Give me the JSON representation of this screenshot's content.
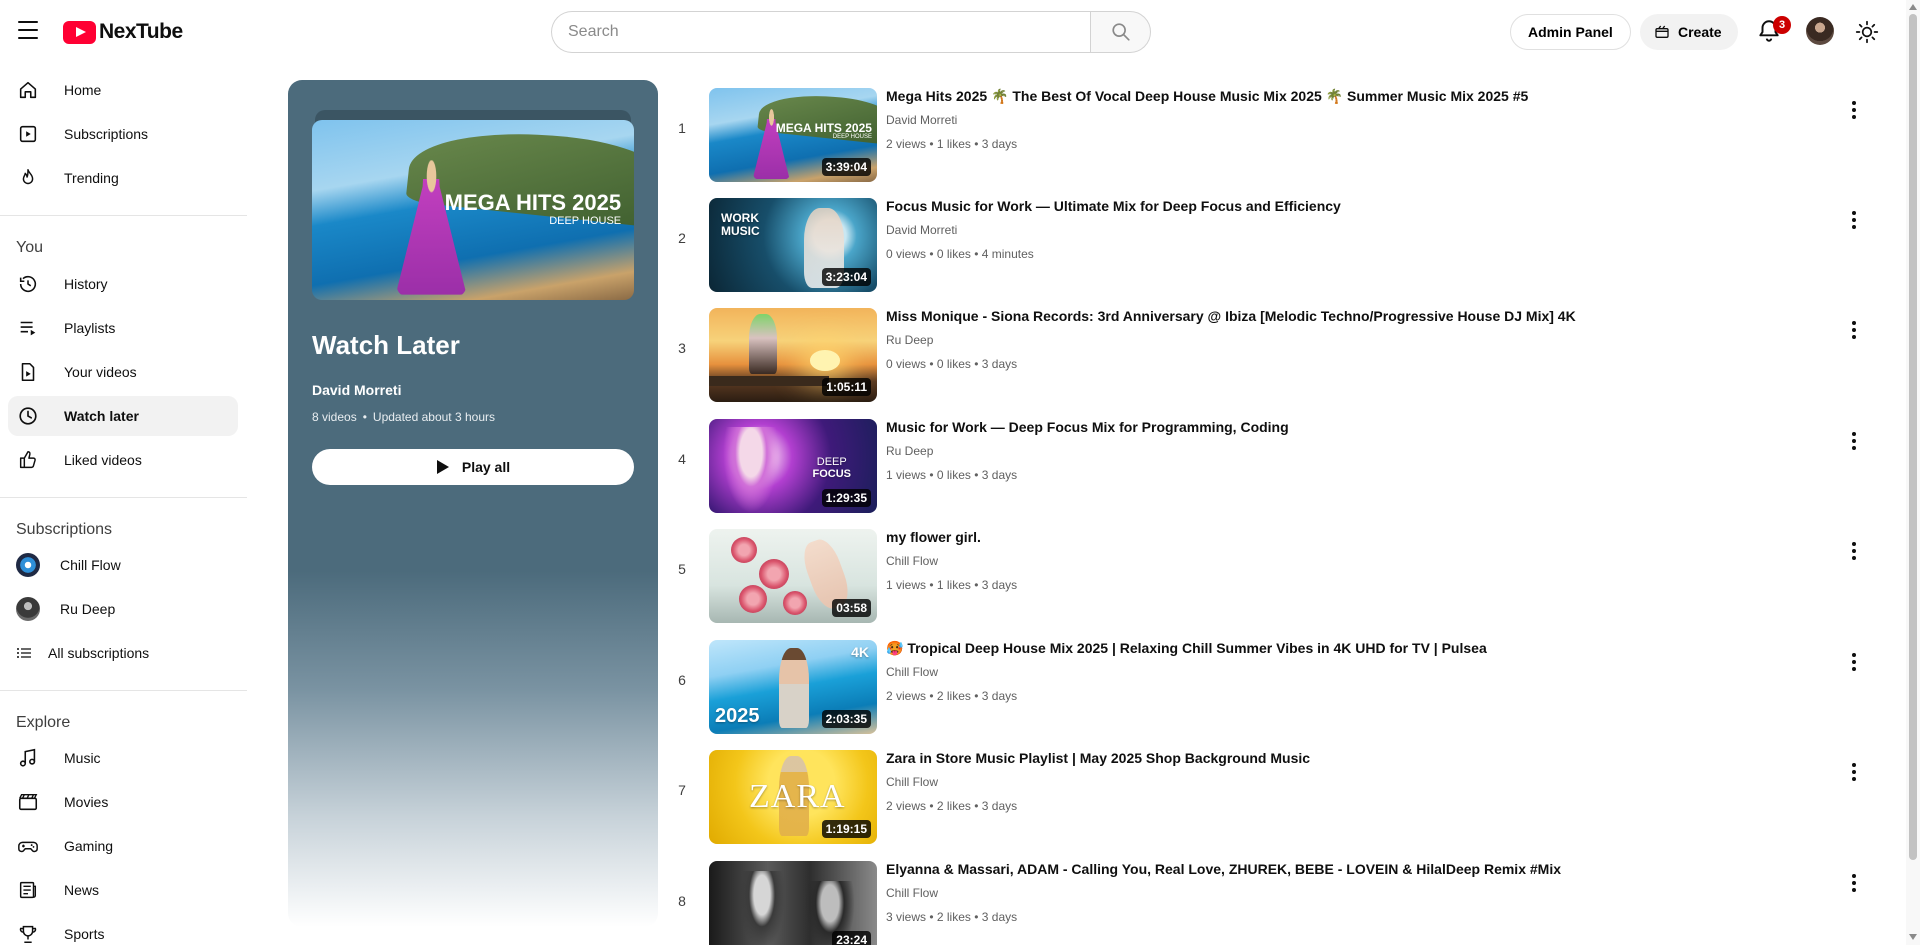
{
  "app": {
    "name": "NexTube",
    "search_placeholder": "Search",
    "admin_label": "Admin Panel",
    "create_label": "Create",
    "notification_count": "3"
  },
  "sidebar": {
    "main": [
      {
        "label": "Home",
        "icon": "home-icon"
      },
      {
        "label": "Subscriptions",
        "icon": "subscriptions-icon"
      },
      {
        "label": "Trending",
        "icon": "trending-icon"
      }
    ],
    "you_title": "You",
    "you": [
      {
        "label": "History",
        "icon": "history-icon"
      },
      {
        "label": "Playlists",
        "icon": "playlists-icon"
      },
      {
        "label": "Your videos",
        "icon": "your-videos-icon"
      },
      {
        "label": "Watch later",
        "icon": "watch-later-icon",
        "active": true
      },
      {
        "label": "Liked videos",
        "icon": "liked-videos-icon"
      }
    ],
    "subs_title": "Subscriptions",
    "subs": [
      {
        "label": "Chill Flow"
      },
      {
        "label": "Ru Deep"
      }
    ],
    "all_subs_label": "All subscriptions",
    "explore_title": "Explore",
    "explore": [
      {
        "label": "Music",
        "icon": "music-icon"
      },
      {
        "label": "Movies",
        "icon": "movies-icon"
      },
      {
        "label": "Gaming",
        "icon": "gaming-icon"
      },
      {
        "label": "News",
        "icon": "news-icon"
      },
      {
        "label": "Sports",
        "icon": "sports-icon"
      }
    ]
  },
  "playlist": {
    "title": "Watch Later",
    "owner": "David Morreti",
    "count": "8 videos",
    "updated": "Updated about 3 hours",
    "play_all_label": "Play all",
    "thumb_title": "MEGA HITS 2025",
    "thumb_subtitle": "DEEP HOUSE"
  },
  "videos": [
    {
      "index": "1",
      "title": "Mega Hits 2025 🌴 The Best Of Vocal Deep House Music Mix 2025 🌴 Summer Music Mix 2025 #5",
      "channel": "David Morreti",
      "meta": "2 views • 1 likes • 3 days",
      "duration": "3:39:04",
      "thumb_line1": "MEGA HITS 2025",
      "thumb_line2": "DEEP HOUSE"
    },
    {
      "index": "2",
      "title": "Focus Music for Work — Ultimate Mix for Deep Focus and Efficiency",
      "channel": "David Morreti",
      "meta": "0 views • 0 likes • 4 minutes",
      "duration": "3:23:04",
      "thumb_line1": "WORK",
      "thumb_line2": "MUSIC"
    },
    {
      "index": "3",
      "title": "Miss Monique - Siona Records: 3rd Anniversary @ Ibiza [Melodic Techno/Progressive House DJ Mix] 4K",
      "channel": "Ru Deep",
      "meta": "0 views • 0 likes • 3 days",
      "duration": "1:05:11"
    },
    {
      "index": "4",
      "title": "Music for Work — Deep Focus Mix for Programming, Coding",
      "channel": "Ru Deep",
      "meta": "1 views • 0 likes • 3 days",
      "duration": "1:29:35",
      "thumb_line1": "DEEP",
      "thumb_line2": "FOCUS"
    },
    {
      "index": "5",
      "title": "my flower girl.",
      "channel": "Chill Flow",
      "meta": "1 views • 1 likes • 3 days",
      "duration": "03:58"
    },
    {
      "index": "6",
      "title": "🥵 Tropical Deep House Mix 2025 | Relaxing Chill Summer Vibes in 4K UHD for TV | Pulsea",
      "channel": "Chill Flow",
      "meta": "2 views • 2 likes • 3 days",
      "duration": "2:03:35",
      "thumb_line1": "4K",
      "thumb_line2": "2025"
    },
    {
      "index": "7",
      "title": "Zara in Store Music Playlist | May 2025 Shop Background Music",
      "channel": "Chill Flow",
      "meta": "2 views • 2 likes • 3 days",
      "duration": "1:19:15",
      "thumb_line1": "ZARA"
    },
    {
      "index": "8",
      "title": "Elyanna & Massari, ADAM - Calling You, Real Love, ZHUREK, BEBE - LOVEIN & HilalDeep Remix #Mix",
      "channel": "Chill Flow",
      "meta": "3 views • 2 likes • 3 days",
      "duration": "23:24"
    }
  ],
  "colors": {
    "brand": "#ff0033",
    "panel": "#4c6b7c",
    "badge": "#cc0000"
  }
}
